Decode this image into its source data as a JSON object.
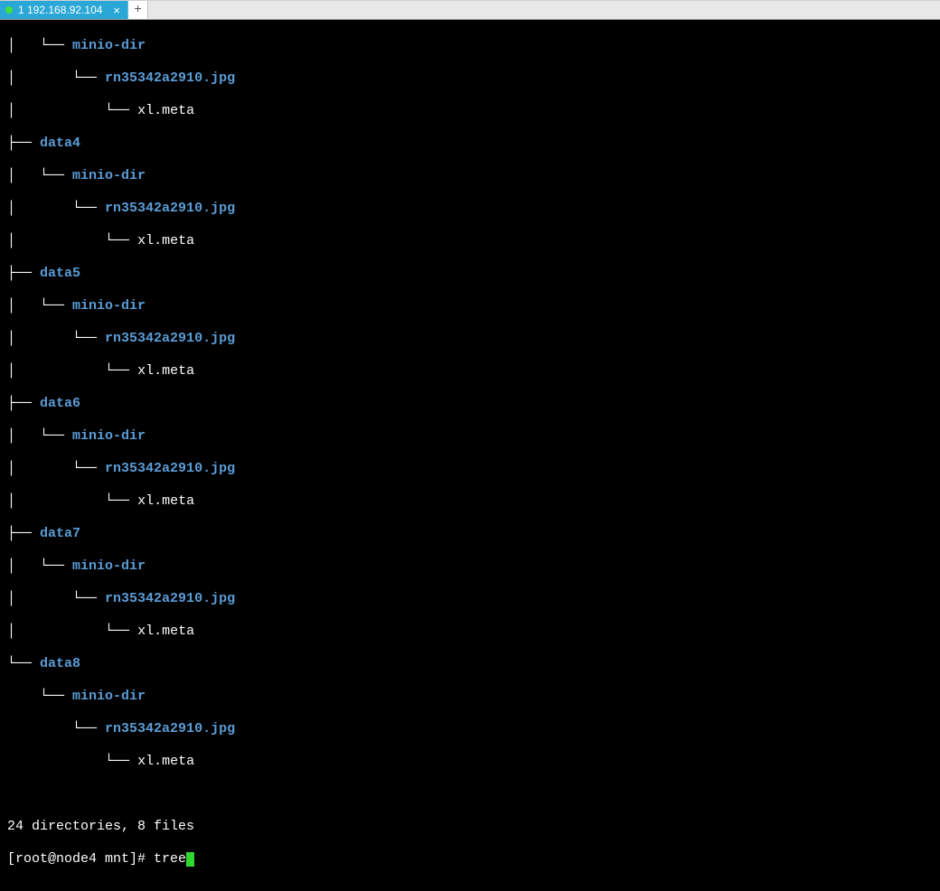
{
  "tabBar": {
    "activeTab": {
      "label": "1 192.168.92.104",
      "statusColor": "#3fe03f"
    },
    "addLabel": "+"
  },
  "tree": {
    "partial0": {
      "dir": "minio-dir",
      "file": "rn35342a2910.jpg",
      "meta": "xl.meta"
    },
    "nodes": [
      {
        "name": "data4",
        "sub": "minio-dir",
        "file": "rn35342a2910.jpg",
        "meta": "xl.meta"
      },
      {
        "name": "data5",
        "sub": "minio-dir",
        "file": "rn35342a2910.jpg",
        "meta": "xl.meta"
      },
      {
        "name": "data6",
        "sub": "minio-dir",
        "file": "rn35342a2910.jpg",
        "meta": "xl.meta"
      },
      {
        "name": "data7",
        "sub": "minio-dir",
        "file": "rn35342a2910.jpg",
        "meta": "xl.meta"
      },
      {
        "name": "data8",
        "sub": "minio-dir",
        "file": "rn35342a2910.jpg",
        "meta": "xl.meta"
      }
    ],
    "summary": "24 directories, 8 files"
  },
  "prompt": {
    "full": "[root@node4 mnt]# ",
    "command": "tree"
  },
  "glyphs": {
    "tee": "├── ",
    "elbow": "└── ",
    "pipe": "│   ",
    "space": "    "
  }
}
